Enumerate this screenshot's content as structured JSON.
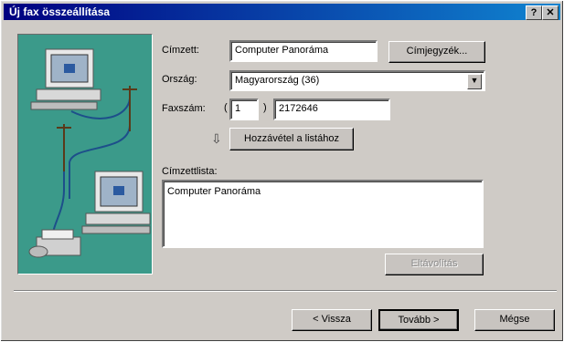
{
  "window": {
    "title": "Új fax összeállítása",
    "help_label": "?",
    "close_label": "✕"
  },
  "form": {
    "recipient_label": "Címzett:",
    "recipient_value": "Computer Panoráma",
    "address_book_button": "Címjegyzék...",
    "country_label": "Ország:",
    "country_value": "Magyarország (36)",
    "fax_label": "Faxszám:",
    "area_open": "(",
    "area_code": "1",
    "area_close": ")",
    "fax_number": "2172646",
    "add_button": "Hozzávétel a listához",
    "list_label": "Címzettlista:",
    "list_items": [
      "Computer Panoráma"
    ],
    "remove_button": "Eltávolítás"
  },
  "footer": {
    "back_button": "< Vissza",
    "next_button": "Tovább >",
    "cancel_button": "Mégse"
  },
  "icons": {
    "add_arrow": "down-arrow-icon"
  },
  "colors": {
    "titlebar": "#000080",
    "illustration_bg": "#3b9a8a"
  }
}
